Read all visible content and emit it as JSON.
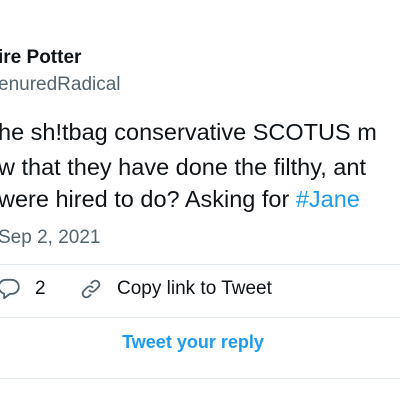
{
  "tweet": {
    "author_name": "ire Potter",
    "author_handle": "enuredRadical",
    "text_lines": [
      "he sh!tbag conservative SCOTUS m",
      "w that they have done the filthy, ant",
      "were hired to do? Asking for "
    ],
    "hashtag": "#Jane",
    "date": "Sep 2, 2021"
  },
  "actions": {
    "reply_icon": "speech-bubble-icon",
    "reply_count": "2",
    "copy_icon": "link-icon",
    "copy_link_label": "Copy link to Tweet"
  },
  "reply_button": {
    "label": "Tweet your reply"
  },
  "colors": {
    "accent": "#1d9bf0",
    "secondary_text": "#536471",
    "primary_text": "#0f1419",
    "divider": "#e1e8ed"
  }
}
